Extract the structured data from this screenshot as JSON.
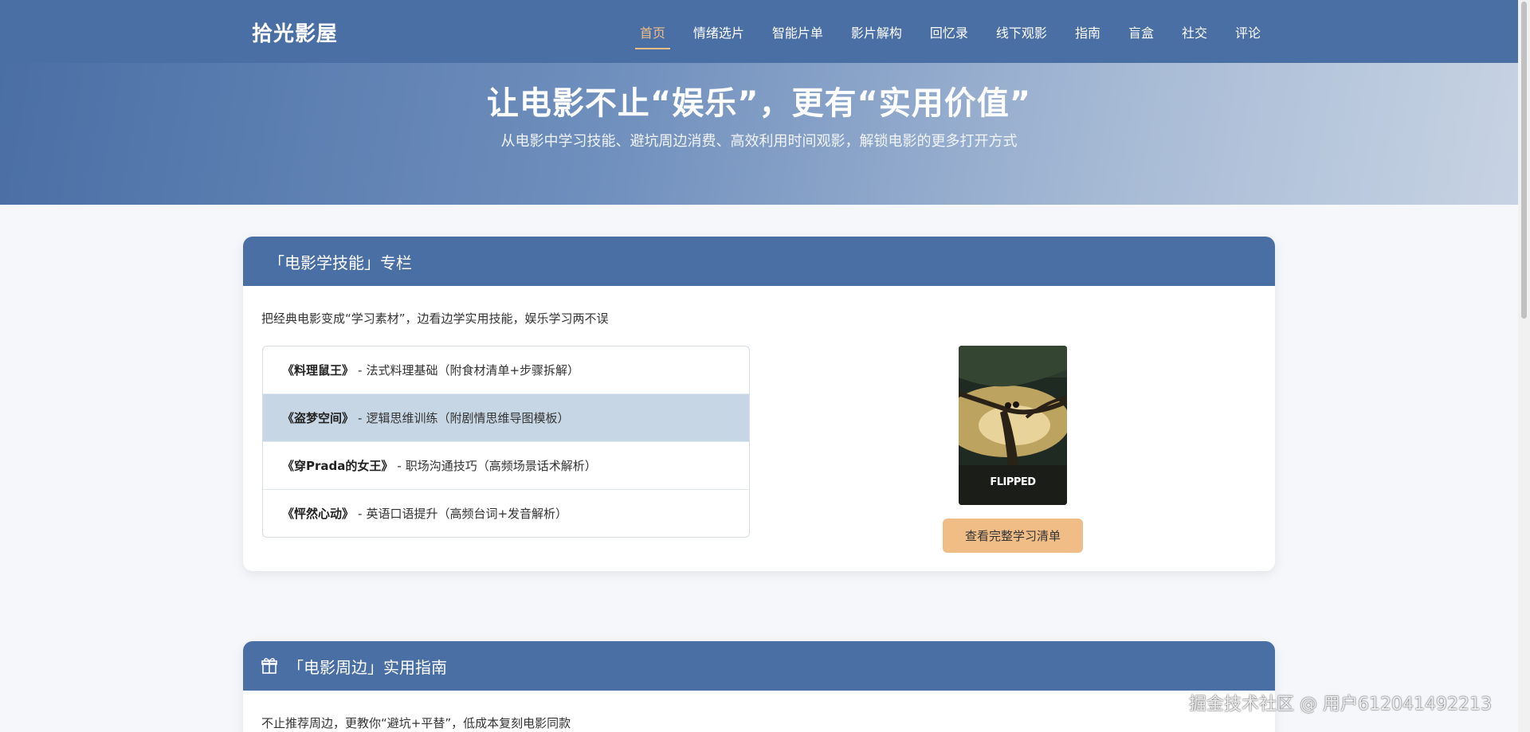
{
  "header": {
    "logo": "拾光影屋",
    "nav": [
      {
        "label": "首页",
        "active": true
      },
      {
        "label": "情绪选片"
      },
      {
        "label": "智能片单"
      },
      {
        "label": "影片解构"
      },
      {
        "label": "回忆录"
      },
      {
        "label": "线下观影"
      },
      {
        "label": "指南"
      },
      {
        "label": "盲盒"
      },
      {
        "label": "社交"
      },
      {
        "label": "评论"
      }
    ]
  },
  "hero": {
    "title": "让电影不止“娱乐”，更有“实用价值”",
    "subtitle": "从电影中学习技能、避坑周边消费、高效利用时间观影，解锁电影的更多打开方式"
  },
  "skills": {
    "title": "「电影学技能」专栏",
    "desc": "把经典电影变成“学习素材”，边看边学实用技能，娱乐学习两不误",
    "items": [
      {
        "movie": "《料理鼠王》",
        "sep": "-",
        "skill": "法式料理基础（附食材清单+步骤拆解）"
      },
      {
        "movie": "《盗梦空间》",
        "sep": "-",
        "skill": "逻辑思维训练（附剧情思维导图模板）",
        "active": true
      },
      {
        "movie": "《穿Prada的女王》",
        "sep": "-",
        "skill": "职场沟通技巧（高频场景话术解析）"
      },
      {
        "movie": "《怦然心动》",
        "sep": "-",
        "skill": "英语口语提升（高频台词+发音解析）"
      }
    ],
    "poster_title": "FLIPPED",
    "button": "查看完整学习清单"
  },
  "merch": {
    "icon": "gift-icon",
    "title": "「电影周边」实用指南",
    "desc": "不止推荐周边，更教你“避坑+平替”，低成本复刻电影同款"
  },
  "watermark": "掘金技术社区 @ 用户612041492213",
  "colors": {
    "primary": "#4a6fa5",
    "accent": "#f0bd87",
    "active_row": "#c7d6e4"
  }
}
